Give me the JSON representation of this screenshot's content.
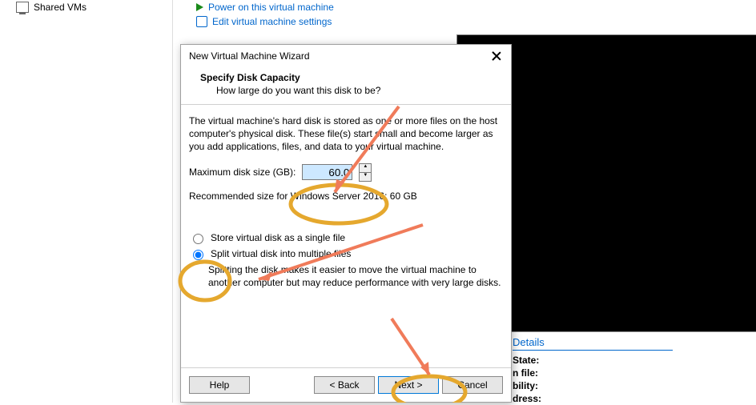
{
  "sidebar": {
    "sharedVMs": "Shared VMs"
  },
  "mainLinks": {
    "powerOn": "Power on this virtual machine",
    "editSettings": "Edit virtual machine settings"
  },
  "detailsPanel": {
    "header": "Details",
    "rows": {
      "state": "State:",
      "file": "n file:",
      "bility": "bility:",
      "dress": "dress:"
    }
  },
  "dialog": {
    "title": "New Virtual Machine Wizard",
    "heading": "Specify Disk Capacity",
    "subheading": "How large do you want this disk to be?",
    "description": "The virtual machine's hard disk is stored as one or more files on the host computer's physical disk. These file(s) start small and become larger as you add applications, files, and data to your virtual machine.",
    "sizeLabel": "Maximum disk size (GB):",
    "sizeValue": "60.0",
    "recommended": "Recommended size for Windows Server 2016: 60 GB",
    "radioSingle": "Store virtual disk as a single file",
    "radioSplit": "Split virtual disk into multiple files",
    "splitHint": "Splitting the disk makes it easier to move the virtual machine to another computer but may reduce performance with very large disks.",
    "buttons": {
      "help": "Help",
      "back": "< Back",
      "next": "Next >",
      "cancel": "Cancel"
    }
  }
}
